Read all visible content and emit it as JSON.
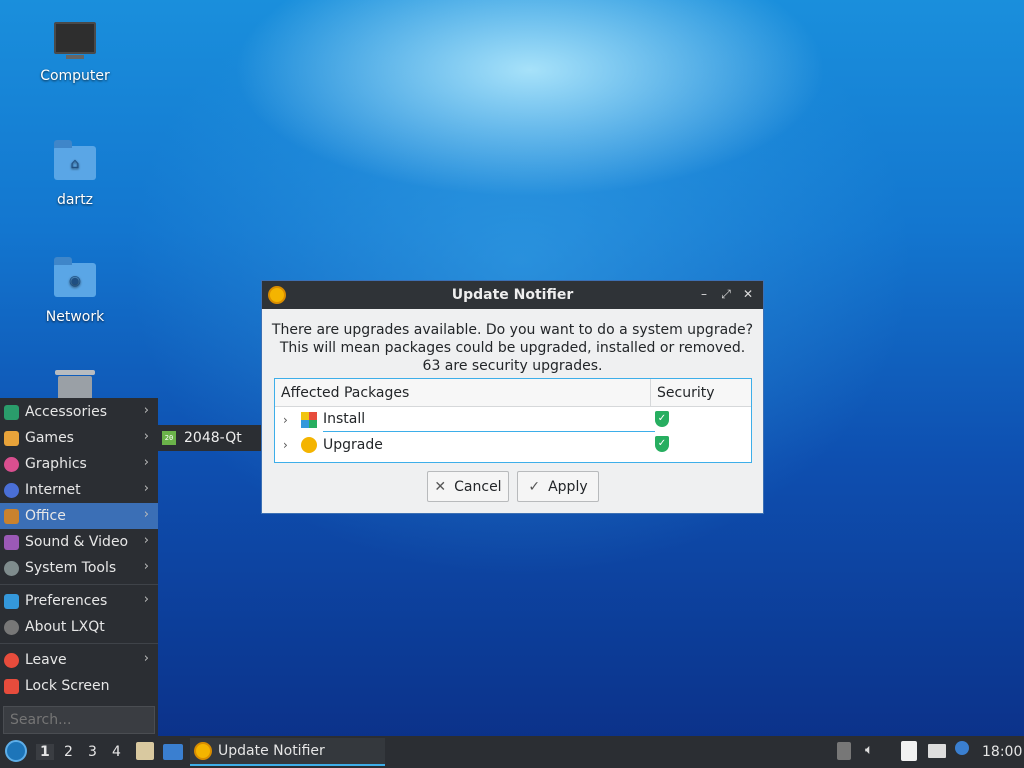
{
  "desktop": {
    "icons": [
      {
        "label": "Computer"
      },
      {
        "label": "dartz"
      },
      {
        "label": "Network"
      }
    ]
  },
  "menu": {
    "items": [
      {
        "label": "Accessories",
        "has_submenu": true,
        "color": "#2a9d6b"
      },
      {
        "label": "Games",
        "has_submenu": true,
        "color": "#e8a33a"
      },
      {
        "label": "Graphics",
        "has_submenu": true,
        "color": "#d94f8f"
      },
      {
        "label": "Internet",
        "has_submenu": true,
        "color": "#4a6fd6"
      },
      {
        "label": "Office",
        "has_submenu": true,
        "color": "#c9822e"
      },
      {
        "label": "Sound & Video",
        "has_submenu": true,
        "color": "#9b59b6"
      },
      {
        "label": "System Tools",
        "has_submenu": true,
        "color": "#7f8c8d"
      },
      {
        "label": "Preferences",
        "has_submenu": true,
        "color": "#3498db"
      },
      {
        "label": "About LXQt",
        "has_submenu": false,
        "color": "#777777"
      },
      {
        "label": "Leave",
        "has_submenu": true,
        "color": "#e74c3c"
      },
      {
        "label": "Lock Screen",
        "has_submenu": false,
        "color": "#e74c3c"
      }
    ],
    "active_item": "Office",
    "search_placeholder": "Search...",
    "submenu_item": "2048-Qt"
  },
  "dialog": {
    "title": "Update Notifier",
    "message_line1": "There are upgrades available. Do you want to do a system upgrade?",
    "message_line2": "This will mean packages could be upgraded, installed or removed.",
    "message_line3": "63 are security upgrades.",
    "columns": {
      "packages": "Affected Packages",
      "security": "Security"
    },
    "rows": [
      {
        "label": "Install"
      },
      {
        "label": "Upgrade"
      }
    ],
    "cancel_label": "Cancel",
    "apply_label": "Apply"
  },
  "taskbar": {
    "workspaces": [
      "1",
      "2",
      "3",
      "4"
    ],
    "active_workspace": "1",
    "task_label": "Update Notifier",
    "clock": "18:00"
  },
  "colors": {
    "accent": "#3daee9",
    "panel": "#2b2e33",
    "shield": "#27ae60"
  }
}
